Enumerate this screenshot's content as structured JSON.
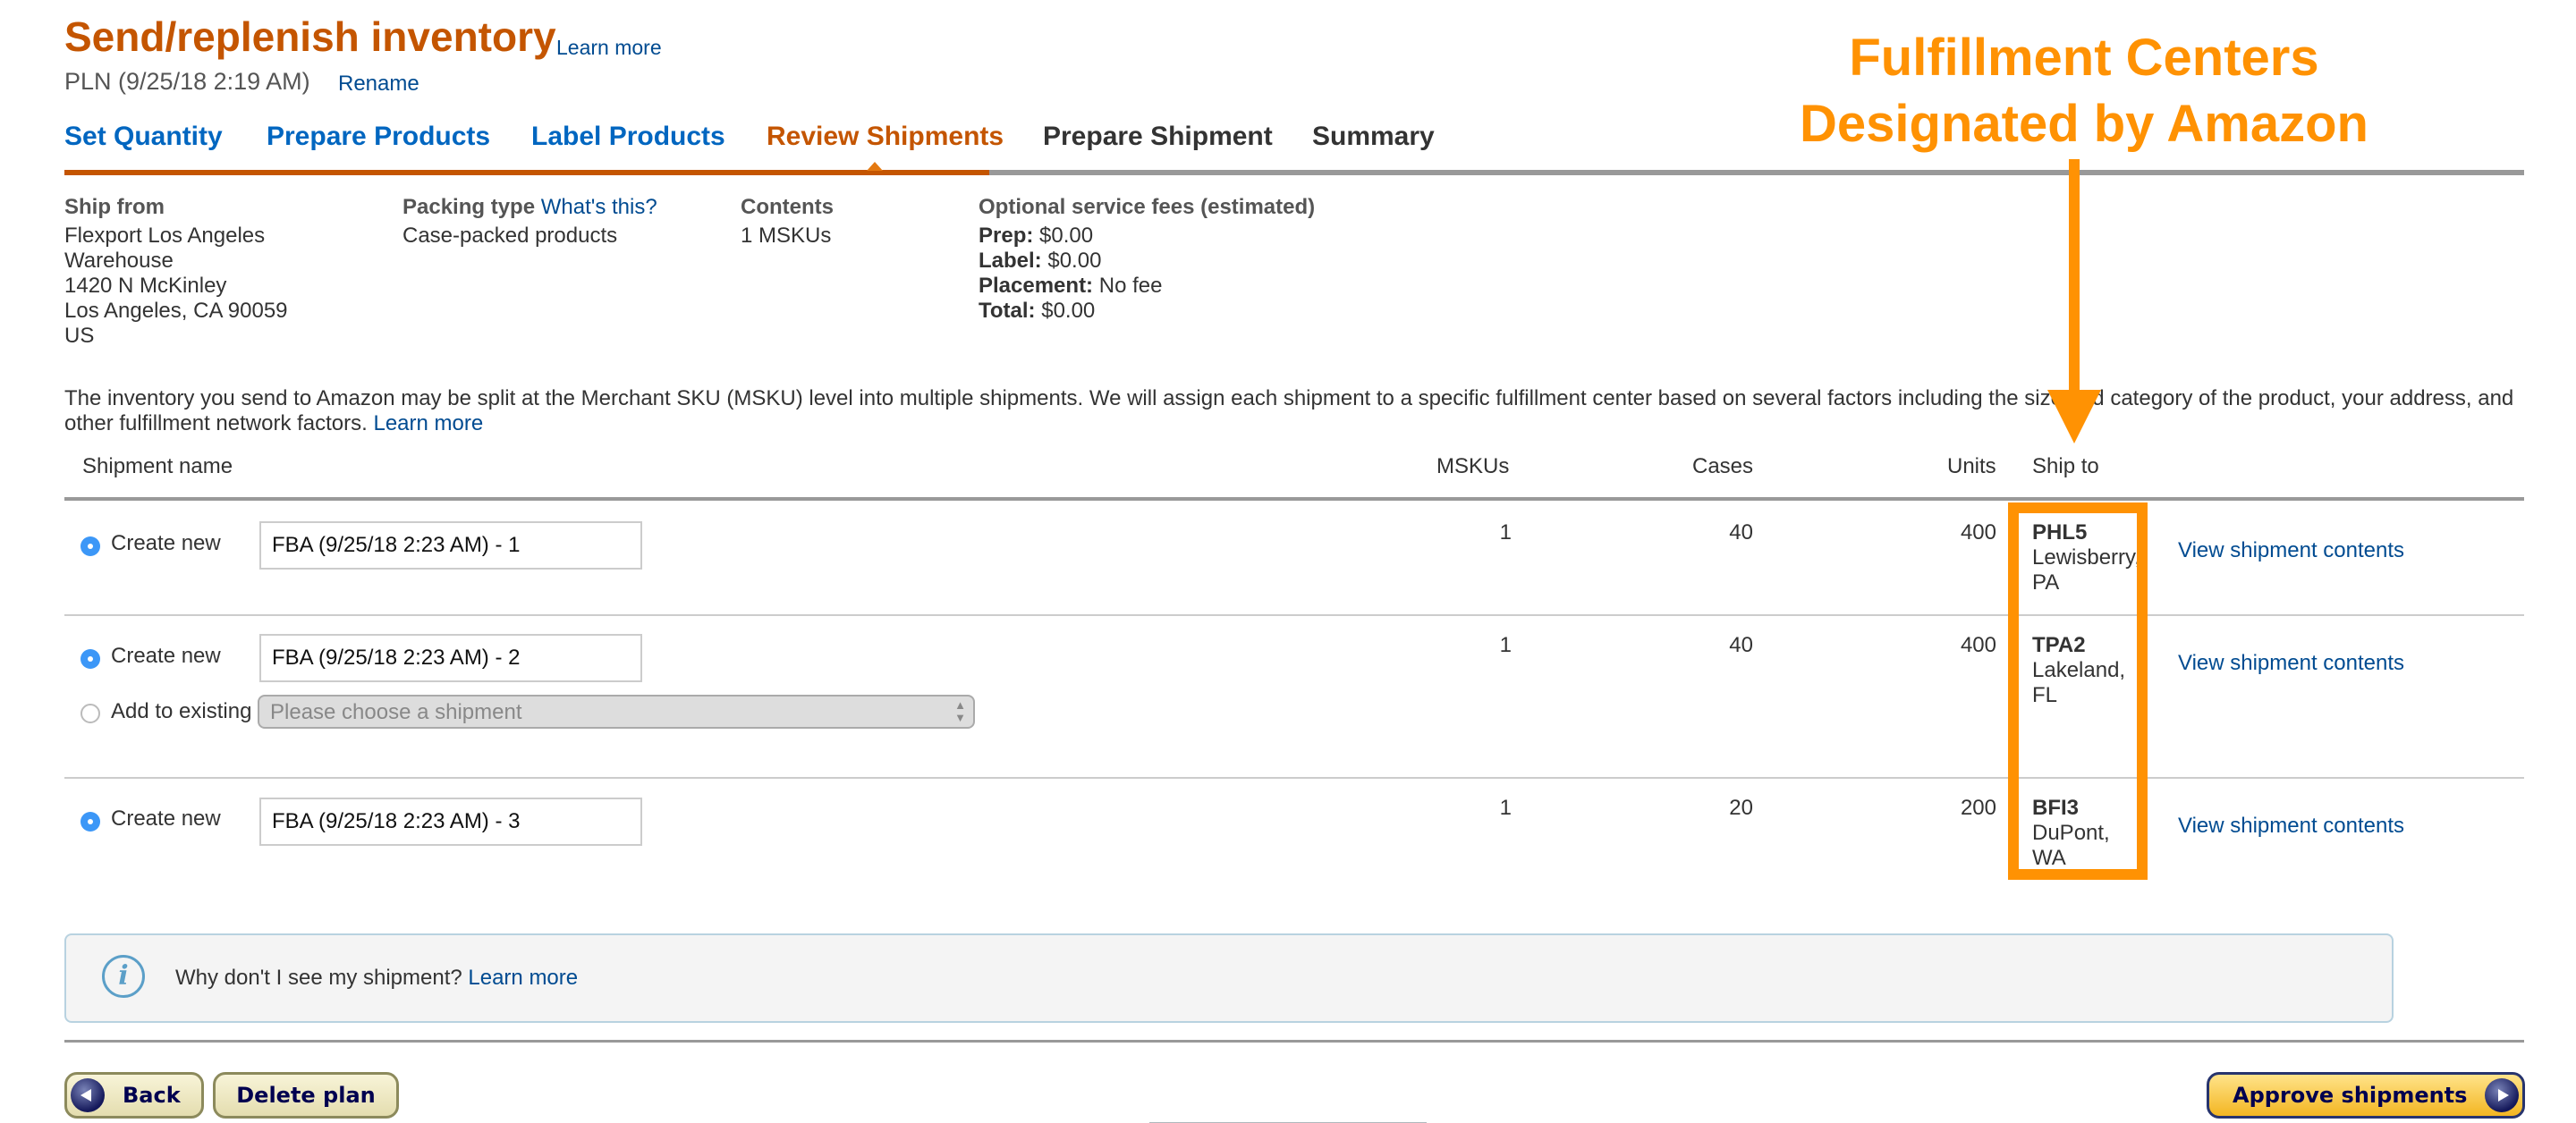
{
  "header": {
    "title": "Send/replenish inventory",
    "learn_more": "Learn more",
    "plan_name": "PLN (9/25/18 2:19 AM)",
    "rename": "Rename"
  },
  "workflow_tabs": [
    {
      "label": "Set Quantity",
      "state": "done"
    },
    {
      "label": "Prepare Products",
      "state": "done"
    },
    {
      "label": "Label Products",
      "state": "done"
    },
    {
      "label": "Review Shipments",
      "state": "active"
    },
    {
      "label": "Prepare Shipment",
      "state": "todo"
    },
    {
      "label": "Summary",
      "state": "todo"
    }
  ],
  "summary": {
    "ship_from": {
      "heading": "Ship from",
      "lines": [
        "Flexport Los Angeles",
        "Warehouse",
        "1420 N McKinley",
        "Los Angeles, CA 90059",
        "US"
      ]
    },
    "packing_type": {
      "heading": "Packing type",
      "whats_this": "What's this?",
      "value": "Case-packed products"
    },
    "contents": {
      "heading": "Contents",
      "value": "1 MSKUs"
    },
    "fees": {
      "heading": "Optional service fees (estimated)",
      "items": [
        {
          "label": "Prep:",
          "value": "$0.00"
        },
        {
          "label": "Label:",
          "value": "$0.00"
        },
        {
          "label": "Placement:",
          "value": "No fee"
        },
        {
          "label": "Total:",
          "value": "$0.00"
        }
      ]
    }
  },
  "description": {
    "text": "The inventory you send to Amazon may be split at the Merchant SKU (MSKU) level into multiple shipments. We will assign each shipment to a specific fulfillment center based on several factors including the size and category of the product, your address, and other fulfillment network factors.",
    "learn_more": "Learn more"
  },
  "table": {
    "columns": {
      "name": "Shipment name",
      "mskus": "MSKUs",
      "cases": "Cases",
      "units": "Units",
      "ship_to": "Ship to"
    },
    "create_new_label": "Create new",
    "add_existing_label": "Add to existing",
    "select_placeholder": "Please choose a shipment",
    "view_contents": "View shipment contents",
    "rows": [
      {
        "name": "FBA (9/25/18 2:23 AM) - 1",
        "mskus": "1",
        "cases": "40",
        "units": "400",
        "fc_code": "PHL5",
        "fc_city": "Lewisberry,",
        "fc_state": "PA"
      },
      {
        "name": "FBA (9/25/18 2:23 AM) - 2",
        "mskus": "1",
        "cases": "40",
        "units": "400",
        "fc_code": "TPA2",
        "fc_city": "Lakeland,",
        "fc_state": "FL"
      },
      {
        "name": "FBA (9/25/18 2:23 AM) - 3",
        "mskus": "1",
        "cases": "20",
        "units": "200",
        "fc_code": "BFI3",
        "fc_city": "DuPont,",
        "fc_state": "WA"
      }
    ]
  },
  "annotation": {
    "line1": "Fulfillment Centers",
    "line2": "Designated by Amazon",
    "color": "#ff9203"
  },
  "info_box": {
    "icon": "info-icon",
    "text": "Why don't I see my shipment?",
    "learn_more": "Learn more"
  },
  "buttons": {
    "back": "Back",
    "delete_plan": "Delete plan",
    "approve": "Approve shipments"
  },
  "colors": {
    "brand_orange": "#c45500",
    "link_blue": "#004b91",
    "tab_blue": "#0066c0",
    "radio_blue": "#3c97f7"
  }
}
